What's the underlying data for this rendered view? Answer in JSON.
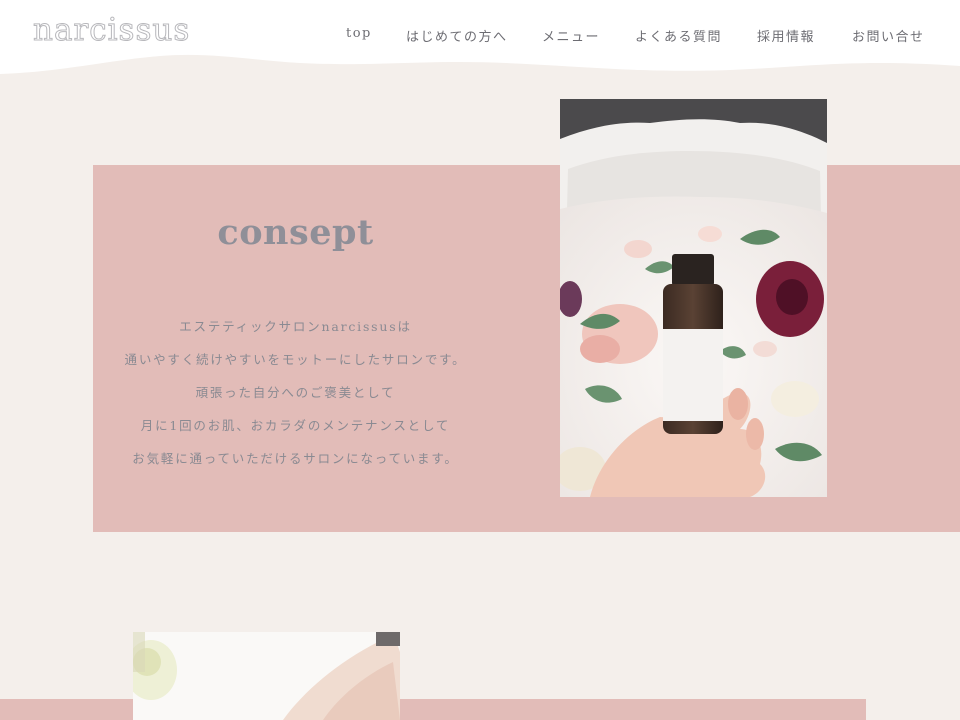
{
  "header": {
    "logo": "narcissus",
    "nav": [
      {
        "label": "top"
      },
      {
        "label": "はじめての方へ"
      },
      {
        "label": "メニュー"
      },
      {
        "label": "よくある質問"
      },
      {
        "label": "採用情報"
      },
      {
        "label": "お問い合せ"
      }
    ]
  },
  "concept": {
    "title": "consept",
    "lines": [
      "エステティックサロンnarcissusは",
      "通いやすく続けやすいをモットーにしたサロンです。",
      "頑張った自分へのご褒美として",
      "月に1回のお肌、おカラダのメンテナンスとして",
      "お気軽に通っていただけるサロンになっています。"
    ]
  },
  "colors": {
    "background": "#f4efeb",
    "accent_pink": "#e2bcb8",
    "text_gray": "#8a8a92"
  }
}
